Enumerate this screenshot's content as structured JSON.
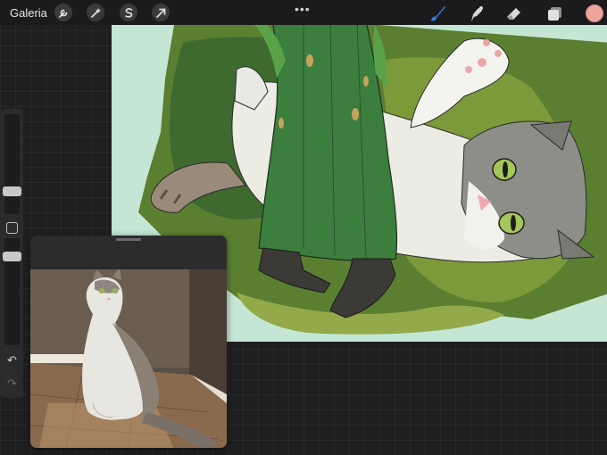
{
  "topbar": {
    "gallery_label": "Galeria",
    "icons": [
      "wrench-icon",
      "magic-wand-icon",
      "selection-icon",
      "transform-arrow-icon"
    ],
    "more_label": "•••",
    "tools": [
      "brush-icon",
      "smudge-icon",
      "eraser-icon",
      "layers-icon"
    ],
    "active_color": "#eda49a",
    "active_tool_color": "#2f7fe0"
  },
  "sidebar": {
    "brush_size_level": 0.28,
    "opacity_level": 0.35,
    "undo_symbol": "↶",
    "redo_symbol": "↷"
  },
  "canvas": {
    "description_colors": {
      "background": "#c5e6d4",
      "grass": "#6f8f3a",
      "dress": "#3c7e3e"
    }
  }
}
